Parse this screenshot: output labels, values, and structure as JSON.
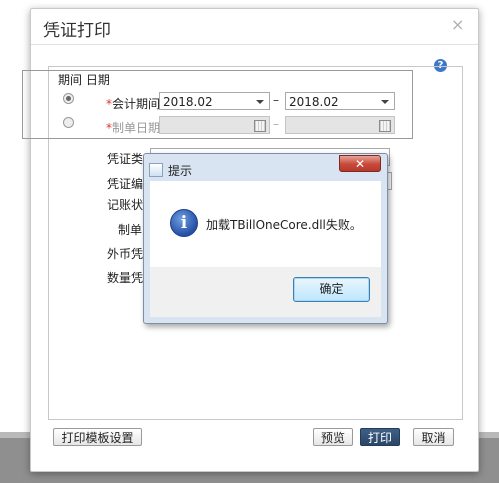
{
  "dialog": {
    "title": "凭证打印",
    "close_glyph": "×",
    "help_glyph": "?"
  },
  "period": {
    "legend": "期间 日期",
    "accounting_period": {
      "required_mark": "*",
      "label": "会计期间",
      "from": "2018.02",
      "separator": "–",
      "to": "2018.02",
      "selected": true
    },
    "voucher_date": {
      "required_mark": "*",
      "label": "制单日期",
      "from": "",
      "separator": "–",
      "to": "",
      "selected": false
    }
  },
  "fields": {
    "voucher_type": "凭证类",
    "voucher_no": "凭证编",
    "posting_status": "记账状",
    "preparer": "制单",
    "foreign_currency": "外币凭",
    "quantity": "数量凭"
  },
  "footer": {
    "template_settings": "打印模板设置",
    "preview": "预览",
    "print": "打印",
    "cancel": "取消"
  },
  "message_box": {
    "title": "提示",
    "close_glyph": "✕",
    "icon_glyph": "i",
    "text": "加载TBillOneCore.dll失败。",
    "ok": "确定"
  },
  "colors": {
    "required": "#e03030",
    "primary_button": "#2a4668",
    "info_icon": "#2450a6"
  }
}
